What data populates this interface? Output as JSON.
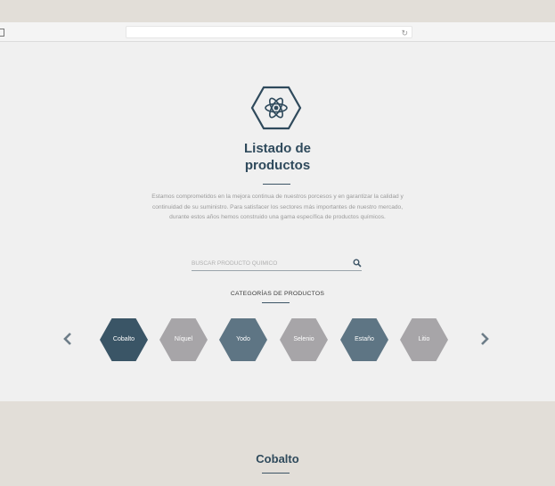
{
  "page": {
    "title_line1": "Listado de",
    "title_line2": "productos",
    "intro": "Estamos comprometidos en la mejora continua de nuestros porcesos y en garantizar la calidad y continuidad de su suministro. Para satisfacer los sectores más importantes de nuestro mercado, durante estos años hemos construido una gama específica de productos químicos."
  },
  "search": {
    "placeholder": "BUSCAR PRODUCTO QUÍMICO",
    "icon": "search-icon"
  },
  "categories": {
    "title": "CATEGORÍAS DE PRODUCTOS",
    "items": [
      {
        "label": "Cobalto",
        "color": "#3a5566",
        "selected": true
      },
      {
        "label": "Níquel",
        "color": "#a7a5a8",
        "selected": false
      },
      {
        "label": "Yodo",
        "color": "#5e7584",
        "selected": false
      },
      {
        "label": "Selenio",
        "color": "#a7a5a8",
        "selected": false
      },
      {
        "label": "Estaño",
        "color": "#5e7584",
        "selected": false
      },
      {
        "label": "Litio",
        "color": "#a7a5a8",
        "selected": false
      }
    ],
    "prev_icon": "chevron-left-icon",
    "next_icon": "chevron-right-icon"
  },
  "detail": {
    "title": "Cobalto"
  },
  "colors": {
    "brand_dark": "#2f4a5c",
    "hero_bg": "#f0f0f0",
    "page_bg": "#e2ded8"
  }
}
